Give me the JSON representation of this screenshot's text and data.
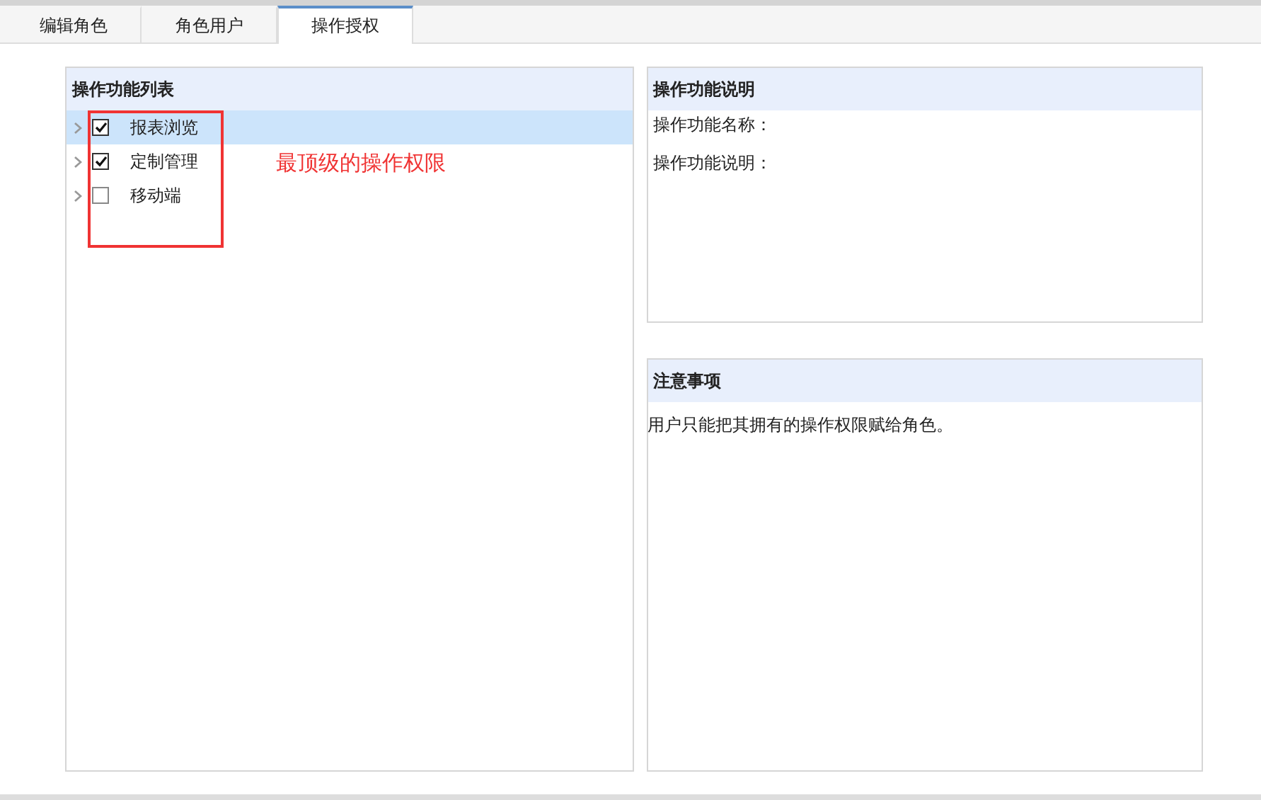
{
  "tabs": [
    {
      "label": "编辑角色",
      "selected": false
    },
    {
      "label": "角色用户",
      "selected": false
    },
    {
      "label": "操作授权",
      "selected": true
    }
  ],
  "function_list": {
    "title": "操作功能列表",
    "items": [
      {
        "label": "报表浏览",
        "checked": true,
        "selected": true,
        "expanded": false
      },
      {
        "label": "定制管理",
        "checked": true,
        "selected": false,
        "expanded": false
      },
      {
        "label": "移动端",
        "checked": false,
        "selected": false,
        "expanded": false
      }
    ]
  },
  "annotation": {
    "text": "最顶级的操作权限"
  },
  "description": {
    "title": "操作功能说明",
    "fields": [
      "操作功能名称：",
      "操作功能说明："
    ]
  },
  "notes": {
    "title": "注意事项",
    "text": "用户只能把其拥有的操作权限赋给角色。"
  }
}
